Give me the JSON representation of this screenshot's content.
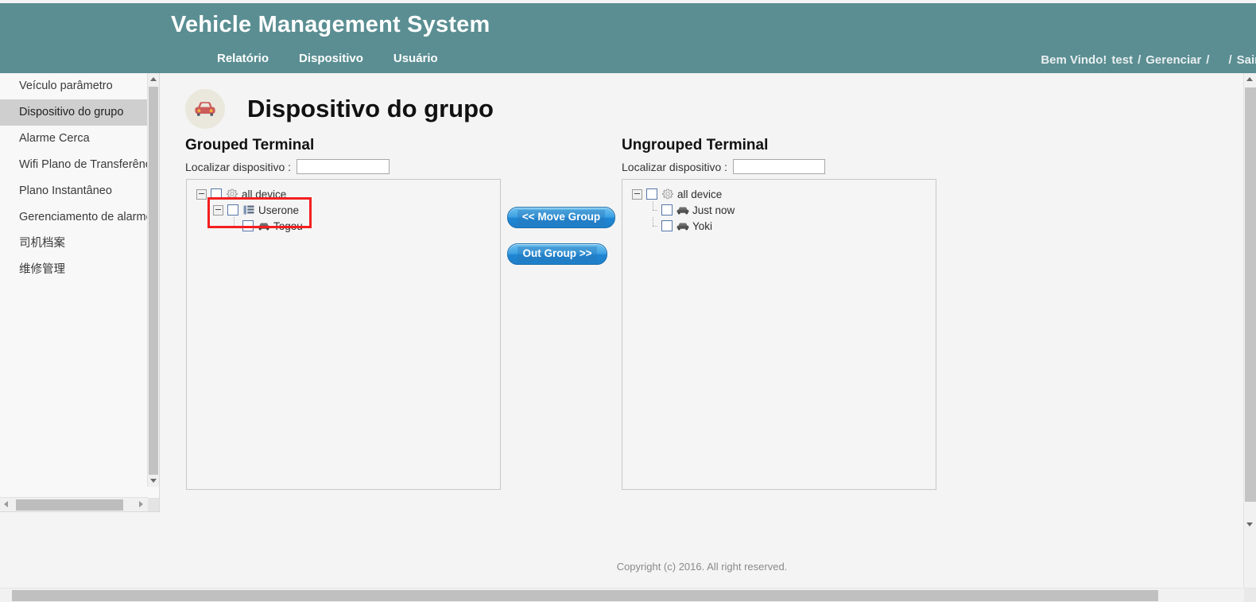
{
  "header": {
    "app_title": "Vehicle Management System",
    "background_color": "#5a8e92",
    "nav": [
      {
        "label": "Relatório",
        "name": "nav-relatorio"
      },
      {
        "label": "Dispositivo",
        "name": "nav-dispositivo"
      },
      {
        "label": "Usuário",
        "name": "nav-usuario"
      }
    ],
    "welcome": {
      "greeting": "Bem Vindo!",
      "username": "test",
      "separator": "/",
      "manage": "Gerenciar",
      "logout": "Sair"
    }
  },
  "sidebar": {
    "items": [
      {
        "label": "Veículo parâmetro",
        "active": false,
        "cjk": false
      },
      {
        "label": "Dispositivo do grupo",
        "active": true,
        "cjk": false
      },
      {
        "label": "Alarme Cerca",
        "active": false,
        "cjk": false
      },
      {
        "label": "Wifi Plano de Transferênc",
        "active": false,
        "cjk": false
      },
      {
        "label": "Plano Instantâneo",
        "active": false,
        "cjk": false
      },
      {
        "label": "Gerenciamento de alarme",
        "active": false,
        "cjk": false
      },
      {
        "label": "司机档案",
        "active": false,
        "cjk": true
      },
      {
        "label": "维修管理",
        "active": false,
        "cjk": true
      }
    ],
    "active_highlight_color": "#cfcfcf"
  },
  "main": {
    "page_title": "Dispositivo do grupo",
    "page_icon": "car-icon",
    "icon_color": "#cc5b5b",
    "icon_bg_color": "#eae8dc",
    "left_panel": {
      "heading": "Grouped Terminal",
      "find_label": "Localizar dispositivo :",
      "find_value": "",
      "find_placeholder": "",
      "tree": [
        {
          "label": "all device",
          "icon": "gear-icon",
          "level": 1,
          "expander": true,
          "checked": false
        },
        {
          "label": "Userone",
          "icon": "group-list-icon",
          "level": 2,
          "expander": true,
          "checked": false
        },
        {
          "label": "Togou",
          "icon": "car-icon",
          "level": 3,
          "expander": false,
          "checked": false
        }
      ],
      "annotation": {
        "type": "red-rectangle",
        "color": "#f41f1f"
      }
    },
    "right_panel": {
      "heading": "Ungrouped Terminal",
      "find_label": "Localizar dispositivo :",
      "find_value": "",
      "find_placeholder": "",
      "tree": [
        {
          "label": "all device",
          "icon": "gear-icon",
          "level": 1,
          "expander": true,
          "checked": false
        },
        {
          "label": "Just now",
          "icon": "car-icon",
          "level": 2,
          "expander": false,
          "checked": false
        },
        {
          "label": "Yoki",
          "icon": "car-icon",
          "level": 2,
          "expander": false,
          "checked": false
        }
      ]
    },
    "buttons": {
      "move_group": "<< Move Group",
      "out_group": "Out Group >>",
      "accent_color": "#2f97dd"
    }
  },
  "footer": {
    "copyright": "Copyright (c) 2016. All right reserved."
  }
}
